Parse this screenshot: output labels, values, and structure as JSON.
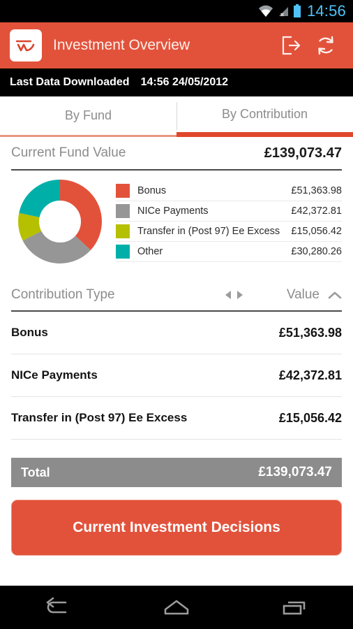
{
  "status_bar": {
    "time": "14:56",
    "icons": [
      "wifi-icon",
      "cellular-no-signal-icon",
      "battery-icon"
    ]
  },
  "app_bar": {
    "logo": "app-logo-icon",
    "title": "Investment Overview",
    "actions": [
      {
        "name": "logout-icon",
        "label": "Logout"
      },
      {
        "name": "refresh-icon",
        "label": "Refresh"
      }
    ]
  },
  "download_bar": {
    "label": "Last Data Downloaded",
    "timestamp": "14:56 24/05/2012"
  },
  "tabs": [
    {
      "label": "By Fund",
      "active": false
    },
    {
      "label": "By Contribution",
      "active": true
    }
  ],
  "fund_value": {
    "label": "Current Fund Value",
    "value": "£139,073.47"
  },
  "chart_data": {
    "type": "pie",
    "variant": "donut",
    "title": "Current Fund Value",
    "categories": [
      "Bonus",
      "NICe Payments",
      "Transfer in (Post 97) Ee Excess",
      "Other"
    ],
    "values": [
      51363.98,
      42372.81,
      15056.42,
      30280.26
    ],
    "value_labels": [
      "£51,363.98",
      "£42,372.81",
      "£15,056.42",
      "£30,280.26"
    ],
    "colors": [
      "#e2523b",
      "#969696",
      "#b5c000",
      "#00b0a8"
    ],
    "total": 139073.47,
    "total_label": "£139,073.47",
    "percentages": [
      36.9,
      30.5,
      10.8,
      21.8
    ],
    "legend_position": "right",
    "start_angle_deg": 0,
    "direction": "clockwise",
    "inner_radius_ratio": 0.46,
    "currency": "GBP"
  },
  "sort_header": {
    "left_label": "Contribution Type",
    "pager_prev": "triangle-left-icon",
    "pager_next": "triangle-right-icon",
    "right_label": "Value",
    "sort_direction_icon": "chevron-up-icon"
  },
  "rows": [
    {
      "name": "Bonus",
      "value": "£51,363.98"
    },
    {
      "name": "NICe Payments",
      "value": "£42,372.81"
    },
    {
      "name": "Transfer in (Post 97) Ee Excess",
      "value": "£15,056.42"
    }
  ],
  "total": {
    "label": "Total",
    "value": "£139,073.47"
  },
  "cta": {
    "label": "Current Investment Decisions"
  },
  "nav_bar": {
    "buttons": [
      {
        "name": "back-icon",
        "label": "Back"
      },
      {
        "name": "home-icon",
        "label": "Home"
      },
      {
        "name": "recent-apps-icon",
        "label": "Recent apps"
      }
    ]
  },
  "colors": {
    "brand": "#e2523b",
    "accent_active_tab": "#e0472b",
    "total_bar": "#8c8c8c",
    "status_time": "#4fc3f7"
  }
}
